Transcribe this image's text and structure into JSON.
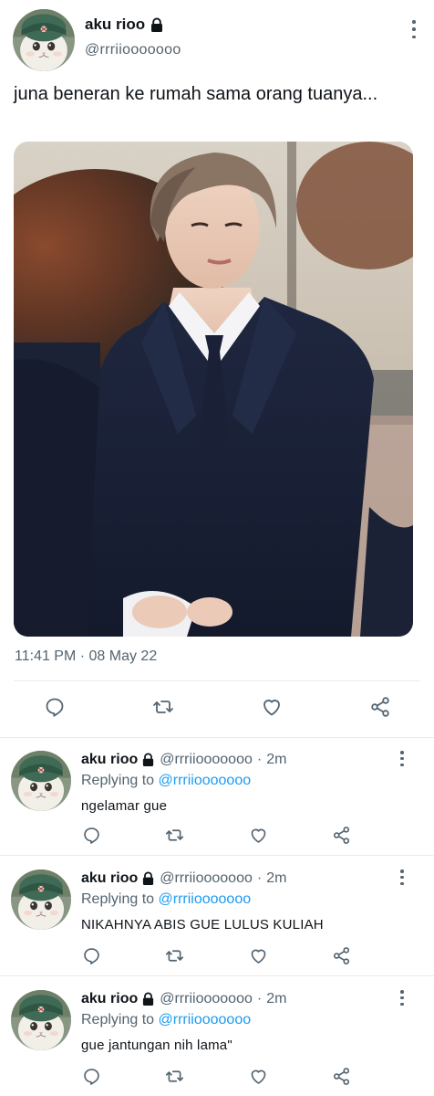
{
  "main_tweet": {
    "display_name": "aku rioo",
    "handle": "@rrriiooooooo",
    "text": "juna beneran ke rumah sama orang tuanya...",
    "timestamp": "11:41 PM · 08 May 22",
    "icons": [
      "lock-icon",
      "more-icon",
      "reply-icon",
      "retweet-icon",
      "like-icon",
      "share-icon"
    ]
  },
  "replies": [
    {
      "display_name": "aku rioo",
      "handle": "@rrriiooooooo",
      "separator": "·",
      "time": "2m",
      "replying_prefix": "Replying to",
      "replying_to": "@rrriiooooooo",
      "text": "ngelamar gue"
    },
    {
      "display_name": "aku rioo",
      "handle": "@rrriiooooooo",
      "separator": "·",
      "time": "2m",
      "replying_prefix": "Replying to",
      "replying_to": "@rrriiooooooo",
      "text": "NIKAHNYA ABIS GUE LULUS KULIAH"
    },
    {
      "display_name": "aku rioo",
      "handle": "@rrriiooooooo",
      "separator": "·",
      "time": "2m",
      "replying_prefix": "Replying to",
      "replying_to": "@rrriiooooooo",
      "text": "gue jantungan nih lama\""
    }
  ],
  "colors": {
    "text": "#0f1419",
    "secondary": "#536471",
    "link": "#1d9bf0",
    "divider": "#e6ecf0"
  }
}
